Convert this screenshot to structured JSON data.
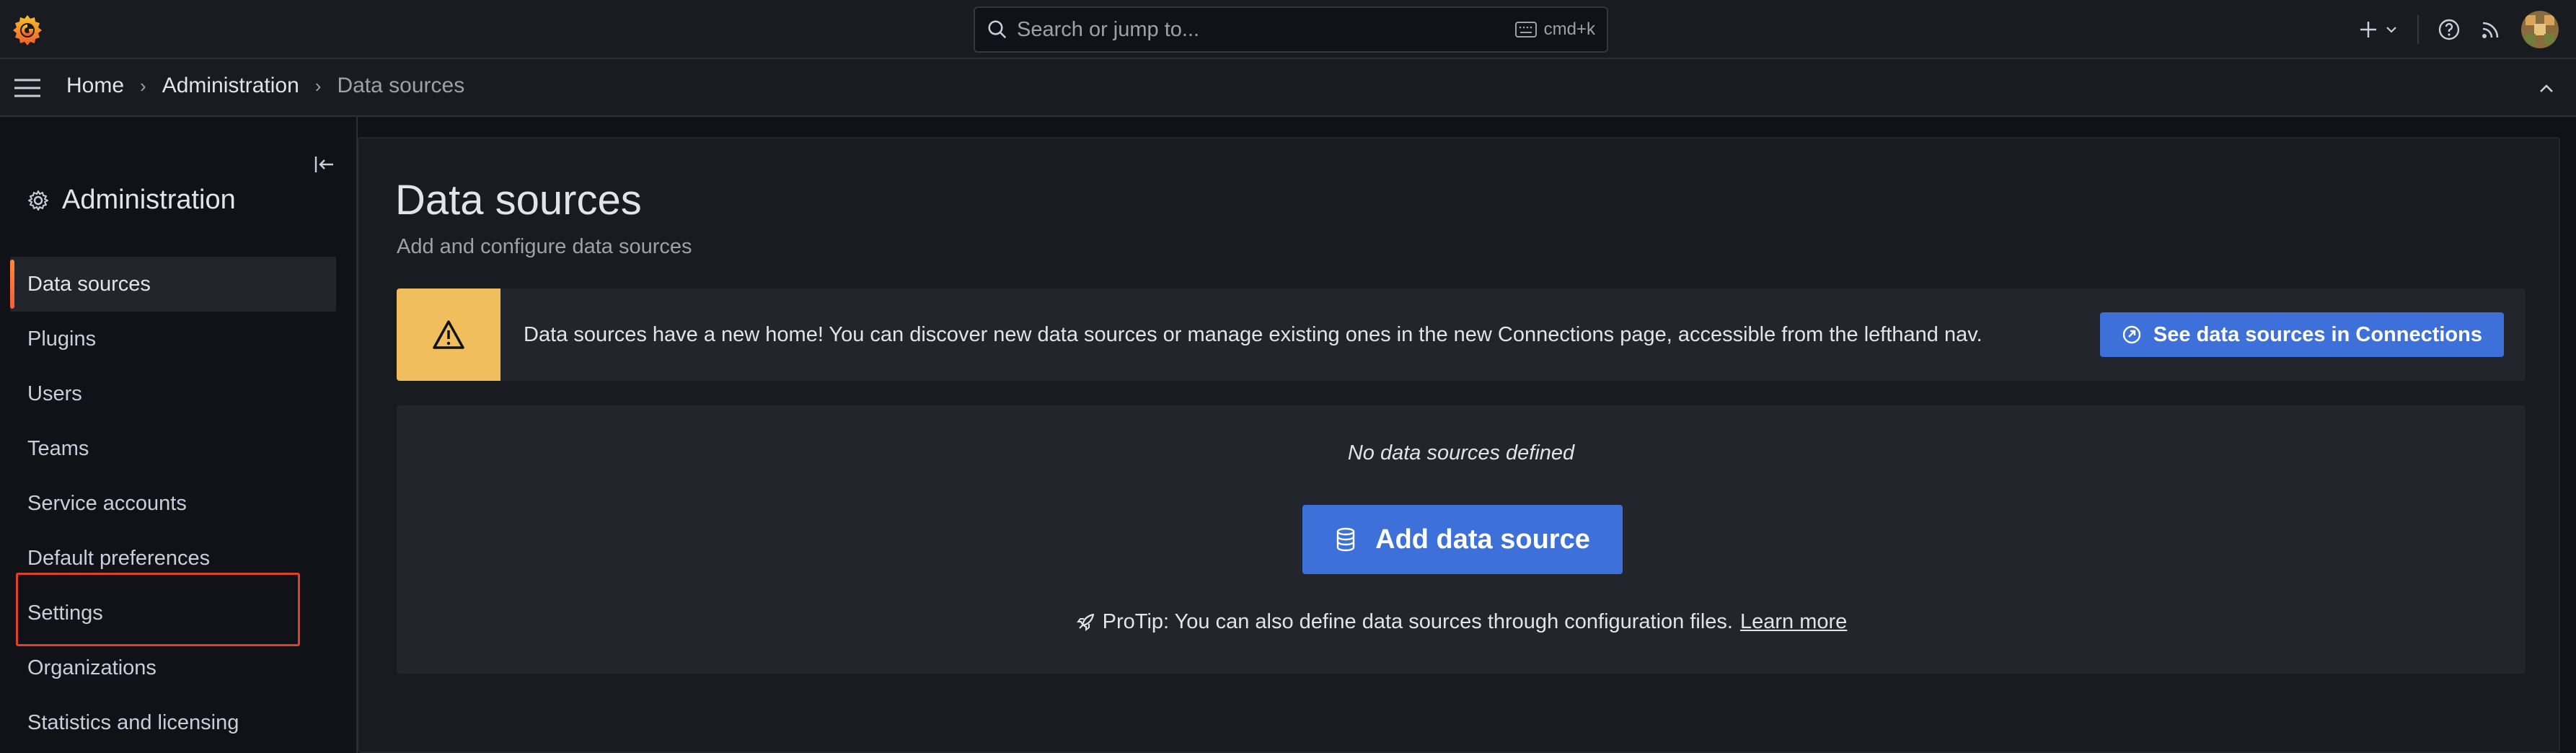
{
  "topbar": {
    "logo_icon": "grafana-logo-icon",
    "search_placeholder": "Search or jump to...",
    "search_shortcut": "cmd+k",
    "icons": [
      "plus-icon",
      "chevron-down-icon",
      "help-icon",
      "news-icon",
      "avatar"
    ]
  },
  "breadcrumb": {
    "items": [
      "Home",
      "Administration",
      "Data sources"
    ],
    "separator": "›"
  },
  "sidebar": {
    "title": "Administration",
    "title_icon": "gear-icon",
    "items": [
      {
        "label": "Data sources",
        "active": true
      },
      {
        "label": "Plugins"
      },
      {
        "label": "Users"
      },
      {
        "label": "Teams"
      },
      {
        "label": "Service accounts"
      },
      {
        "label": "Default preferences"
      },
      {
        "label": "Settings"
      },
      {
        "label": "Organizations"
      },
      {
        "label": "Statistics and licensing"
      }
    ]
  },
  "main": {
    "title": "Data sources",
    "subtitle": "Add and configure data sources",
    "alert": {
      "text": "Data sources have a new home! You can discover new data sources or manage existing ones in the new Connections page, accessible from the lefthand nav.",
      "button": "See data sources in Connections",
      "color": "#f0be5c"
    },
    "empty": {
      "message": "No data sources defined",
      "button": "Add data source",
      "protip": "ProTip: You can also define data sources through configuration files.",
      "learn_more": "Learn more"
    }
  },
  "colors": {
    "primary_button": "#3d71d9",
    "active_accent": "#f55f3e",
    "highlight_box": "#e0402a"
  }
}
